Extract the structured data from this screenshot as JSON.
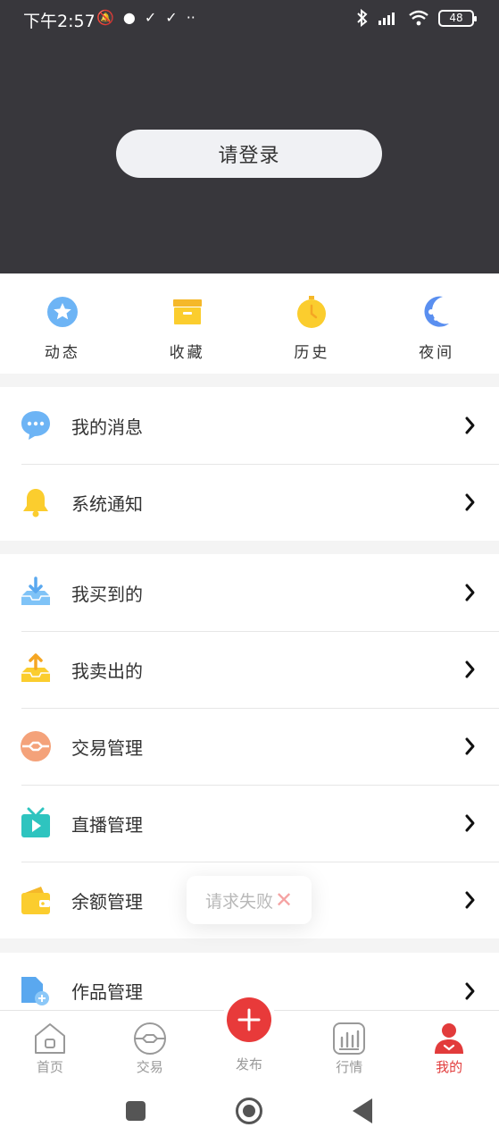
{
  "status_bar": {
    "time": "下午2:57",
    "battery": "48"
  },
  "header": {
    "login_label": "请登录"
  },
  "quick_actions": [
    {
      "label": "动态",
      "icon": "star-circle-icon"
    },
    {
      "label": "收藏",
      "icon": "box-icon"
    },
    {
      "label": "历史",
      "icon": "stopwatch-icon"
    },
    {
      "label": "夜间",
      "icon": "moon-icon"
    }
  ],
  "groups": {
    "messages": [
      {
        "label": "我的消息",
        "icon": "chat-bubble-icon"
      },
      {
        "label": "系统通知",
        "icon": "bell-icon"
      }
    ],
    "management": [
      {
        "label": "我买到的",
        "icon": "download-tray-icon"
      },
      {
        "label": "我卖出的",
        "icon": "upload-tray-icon"
      },
      {
        "label": "交易管理",
        "icon": "trade-icon"
      },
      {
        "label": "直播管理",
        "icon": "tv-play-icon"
      },
      {
        "label": "余额管理",
        "icon": "wallet-icon"
      }
    ],
    "works": [
      {
        "label": "作品管理",
        "icon": "document-add-icon"
      }
    ]
  },
  "toast": {
    "text": "请求失败",
    "icon": "close-x-icon"
  },
  "tabbar": {
    "tabs": [
      {
        "label": "首页",
        "icon": "home-icon"
      },
      {
        "label": "交易",
        "icon": "trade-circle-icon"
      },
      {
        "label": "发布",
        "icon": "plus-icon"
      },
      {
        "label": "行情",
        "icon": "chart-icon"
      },
      {
        "label": "我的",
        "icon": "user-icon",
        "active": true
      }
    ]
  },
  "colors": {
    "header_bg": "#38373c",
    "accent_red": "#e83a3a",
    "yellow": "#fbcd2e",
    "blue": "#5a9bf0"
  }
}
